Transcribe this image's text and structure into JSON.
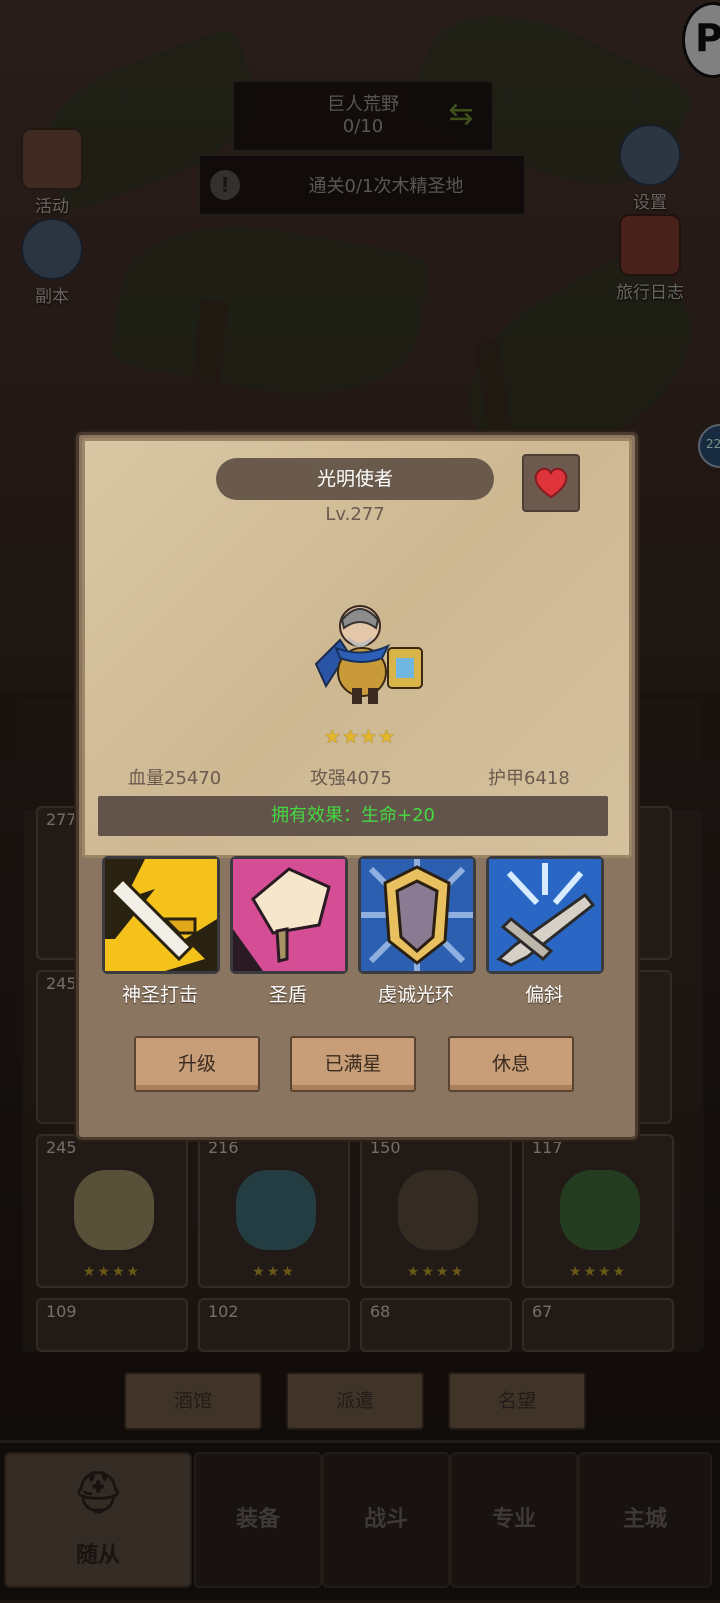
{
  "hud": {
    "stage_name": "巨人荒野",
    "stage_progress": "0/10",
    "quest_text": "通关0/1次木精圣地",
    "left_buttons": [
      {
        "label": "活动"
      },
      {
        "label": "副本"
      }
    ],
    "right_buttons": [
      {
        "label": "设置"
      },
      {
        "label": "旅行日志"
      }
    ]
  },
  "background_grid": {
    "cards": [
      {
        "level": "277",
        "stars": "★★★★"
      },
      {
        "level": "245",
        "stars": "★★★★"
      },
      {
        "level": "245",
        "stars": "★★★★"
      },
      {
        "level": "216",
        "stars": "★★★"
      },
      {
        "level": "150",
        "stars": "★★★★"
      },
      {
        "level": "117",
        "stars": "★★★★"
      },
      {
        "level": "109",
        "stars": ""
      },
      {
        "level": "102",
        "stars": ""
      },
      {
        "level": "68",
        "stars": ""
      },
      {
        "level": "67",
        "stars": ""
      }
    ],
    "bottom_buttons": [
      "酒馆",
      "派遣",
      "名望"
    ]
  },
  "nav": {
    "tabs": [
      "随从",
      "装备",
      "战斗",
      "专业",
      "主城"
    ],
    "active": "随从"
  },
  "dialog": {
    "hero_name": "光明使者",
    "hero_level": "Lv.277",
    "stars": "★★★★",
    "stats": {
      "hp": "血量25470",
      "atk": "攻强4075",
      "armor": "护甲6418"
    },
    "owned_effect": "拥有效果：生命+20",
    "skills": [
      {
        "label": "神圣打击",
        "icon": "holy-strike-icon"
      },
      {
        "label": "圣盾",
        "icon": "holy-shield-icon"
      },
      {
        "label": "虔诚光环",
        "icon": "devotion-aura-icon"
      },
      {
        "label": "偏斜",
        "icon": "deflect-icon"
      }
    ],
    "actions": {
      "upgrade": "升级",
      "max_star": "已满星",
      "rest": "休息"
    }
  },
  "colors": {
    "effect_text": "#45d842",
    "star": "#e2b52a",
    "heart": "#e0343c"
  }
}
